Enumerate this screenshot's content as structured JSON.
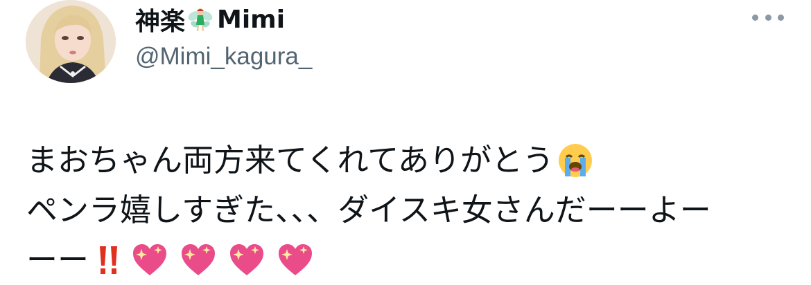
{
  "tweet": {
    "author": {
      "display_name_prefix": "神楽",
      "display_name_suffix": "Mimi",
      "fairy_emoji": "🧚",
      "handle": "@Mimi_kagura_"
    },
    "more_icon": "more-horizontal-icon",
    "text_lines": [
      "まおちゃん両方来てくれてありがとう",
      "ペンラ嬉しすぎた、、、ダイスキ女さんだーーよー",
      "ーー"
    ],
    "emojis": {
      "crying": "😭",
      "double_exclamation": "‼",
      "sparkling_heart": "💖"
    }
  }
}
